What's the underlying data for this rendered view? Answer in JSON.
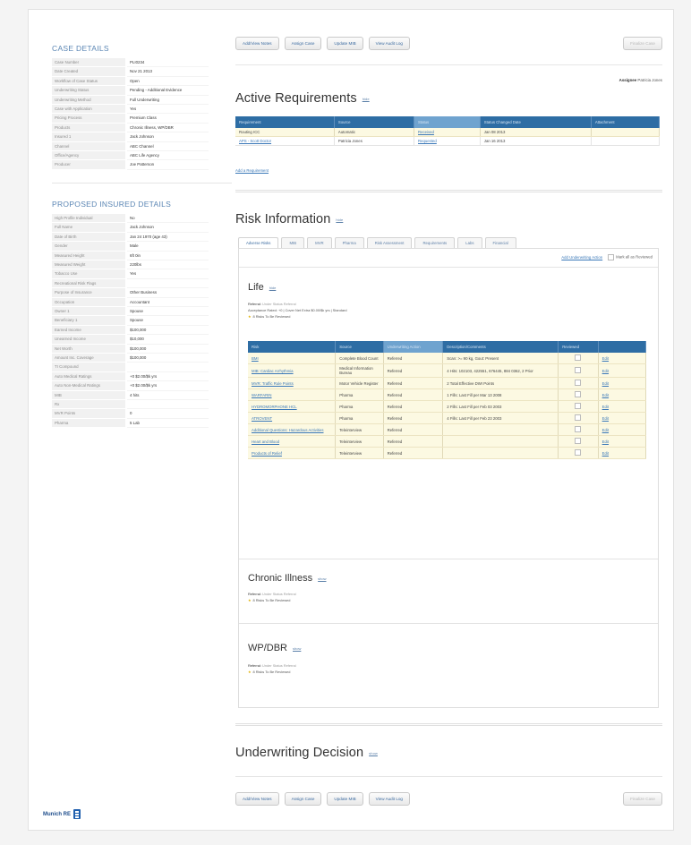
{
  "case_details": {
    "title": "CASE DETAILS",
    "rows": [
      {
        "k": "Case Number",
        "v": "PLI0234"
      },
      {
        "k": "Date Created",
        "v": "Nov 21 2013"
      },
      {
        "k": "Workflow of Case Status",
        "v": "Open"
      },
      {
        "k": "Underwriting Status",
        "v": "Pending - Additional Evidence"
      },
      {
        "k": "Underwriting Method",
        "v": "Full Underwriting"
      },
      {
        "k": "Case with Application",
        "v": "Yes"
      },
      {
        "k": "Pricing Process",
        "v": "Premium Class"
      },
      {
        "k": "Products",
        "v": "Chronic Illness, WP/DBR"
      },
      {
        "k": "Insured 1",
        "v": "Jack Johnson"
      },
      {
        "k": "Channel",
        "v": "ABC Channel"
      },
      {
        "k": "Office/Agency",
        "v": "ABC Life Agency"
      },
      {
        "k": "Producer",
        "v": "Joe Patterson"
      }
    ]
  },
  "insured_details": {
    "title": "PROPOSED INSURED DETAILS",
    "rows": [
      {
        "k": "High Profile Individual",
        "v": "No"
      },
      {
        "k": "Full Name",
        "v": "Jack Johnson"
      },
      {
        "k": "Date of Birth",
        "v": "Jan 24 1970 (age 43)"
      },
      {
        "k": "Gender",
        "v": "Male"
      },
      {
        "k": "Measured Height",
        "v": "6ft 0in"
      },
      {
        "k": "Measured Weight",
        "v": "220lbs"
      },
      {
        "k": "Tobacco Use",
        "v": "Yes"
      },
      {
        "k": "Recreational Risk Flags",
        "v": ""
      },
      {
        "k": "Purpose of Insurance",
        "v": "Other Business"
      },
      {
        "k": "Occupation",
        "v": "Accountant"
      },
      {
        "k": "Owner 1",
        "v": "Spouse"
      },
      {
        "k": "Beneficiary 1",
        "v": "Spouse"
      },
      {
        "k": "Earned Income",
        "v": "$100,000"
      },
      {
        "k": "Unearned Income",
        "v": "$10,000"
      },
      {
        "k": "Net Worth",
        "v": "$100,000"
      },
      {
        "k": "Amount Inc. Coverage",
        "v": "$100,000"
      },
      {
        "k": "TI Compound",
        "v": ""
      },
      {
        "k": "Auto Medical Ratings",
        "v": "+0 $2.00/$k yrs"
      },
      {
        "k": "Auto Non-Medical Ratings",
        "v": "+0 $2.00/$k yrs"
      },
      {
        "k": "MIB",
        "v": "4 hits"
      },
      {
        "k": "Rx",
        "v": ""
      },
      {
        "k": "MVR Points",
        "v": "0"
      },
      {
        "k": "Pharma",
        "v": "5 Lab"
      }
    ]
  },
  "logo": {
    "text": "Munich RE"
  },
  "toolbar": {
    "add_view_notes": "Add/View Notes",
    "assign_case": "Assign Case",
    "update_mib": "Update MIB",
    "view_audit_log": "View Audit Log",
    "finalize_case": "Finalize Case"
  },
  "assignee": {
    "label": "Assignee",
    "value": "Patricia Jones"
  },
  "active_requirements": {
    "title": "Active Requirements",
    "toggle": "hide",
    "columns": [
      "Requirement",
      "Source",
      "Status",
      "Status Changed Date",
      "Attachment"
    ],
    "rows": [
      [
        "Routing ICC",
        "Automatic",
        "Received",
        "Jan 08 2013",
        ""
      ],
      [
        "APS - Scott Doctor",
        "Patricia Jones",
        "Requested",
        "Jan 16 2013",
        ""
      ]
    ],
    "add_link": "Add a Requirement"
  },
  "risk_information": {
    "title": "Risk Information",
    "toggle": "hide",
    "tabs": [
      "Adverse Risks",
      "MIB",
      "MVR",
      "Pharma",
      "Risk Assessment",
      "Requirements",
      "Labs",
      "Financial"
    ],
    "add_action": "Add Underwriting Action",
    "mark_reviewed": "Mark all as Reviewed"
  },
  "life": {
    "title": "Life",
    "toggle": "hide",
    "referral_label": "Referral:",
    "referral_value": "Under Status Referral",
    "decision_line": "Acceptance Rated: +0 | Cover Net Extra $0.00/$k yrs | Standard",
    "risks_line": "8 Risks To Be Reviewed",
    "columns": [
      "Risk",
      "Source",
      "Underwriting Action",
      "Description/Comments",
      "Reviewed",
      ""
    ],
    "rows": [
      {
        "risk": "BMI",
        "source": "Complete Blood Count",
        "action": "Referred",
        "desc": "Scan: >= 90 kg, Gout: Present",
        "edit": "Edit"
      },
      {
        "risk": "MIB: Cardiac Arrhythmia",
        "source": "Medical Information Bureau",
        "action": "Referred",
        "desc": "4 Hits: 102103, 422551, 676445, 884 0362, 2 Prior",
        "edit": "Edit"
      },
      {
        "risk": "MVR: Traffic Rule Points",
        "source": "Motor Vehicle Register",
        "action": "Referred",
        "desc": "2 Total Effective DWI Points",
        "edit": "Edit"
      },
      {
        "risk": "WARFARIN",
        "source": "Pharma",
        "action": "Referred",
        "desc": "1 Fills: Last Fill per Mar 13 2008",
        "edit": "Edit"
      },
      {
        "risk": "HYDROMORPHONE HCL",
        "source": "Pharma",
        "action": "Referred",
        "desc": "2 Fills: Last Fill per Feb 03 2003",
        "edit": "Edit"
      },
      {
        "risk": "ATROVENT",
        "source": "Pharma",
        "action": "Referred",
        "desc": "4 Fills: Last Fill per Feb 23 2003",
        "edit": "Edit"
      },
      {
        "risk": "Additional Questions: Hazardous Activities",
        "source": "Teleinterview",
        "action": "Referred",
        "desc": "",
        "edit": "Edit"
      },
      {
        "risk": "Heart and Blood",
        "source": "Teleinterview",
        "action": "Referred",
        "desc": "",
        "edit": "Edit"
      },
      {
        "risk": "Products of Relief",
        "source": "Teleinterview",
        "action": "Referred",
        "desc": "",
        "edit": "Edit"
      }
    ]
  },
  "chronic_illness": {
    "title": "Chronic Illness",
    "toggle": "show",
    "referral_label": "Referral:",
    "referral_value": "Under Status Referral",
    "risks_line": "8 Risks To Be Reviewed"
  },
  "wpdbr": {
    "title": "WP/DBR",
    "toggle": "show",
    "referral_label": "Referral:",
    "referral_value": "Under Status Referral",
    "risks_line": "8 Risks To Be Reviewed"
  },
  "underwriting_decision": {
    "title": "Underwriting Decision",
    "toggle": "show"
  }
}
